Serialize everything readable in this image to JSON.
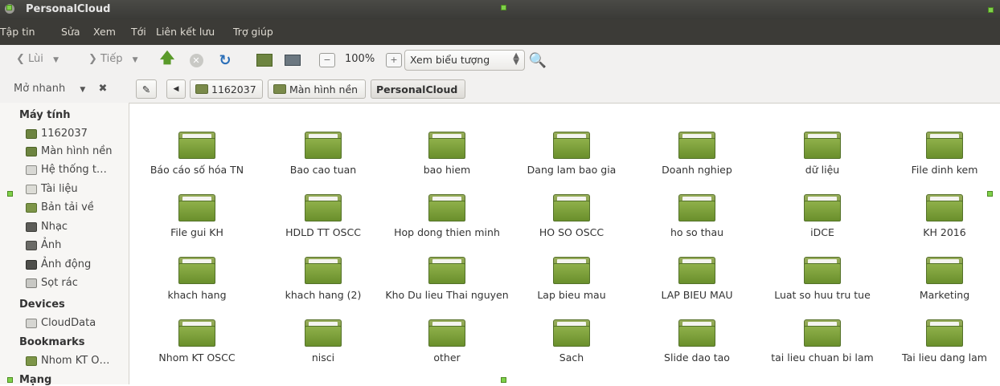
{
  "window": {
    "title": "PersonalCloud"
  },
  "menu": [
    "Tập tin",
    "Sửa",
    "Xem",
    "Tới",
    "Liên kết lưu",
    "Trợ giúp"
  ],
  "toolbar": {
    "back_label": "Lùi",
    "forward_label": "Tiếp",
    "zoom_value": "100%",
    "view_mode": "Xem biểu tượng"
  },
  "location": {
    "quick_label": "Mở nhanh",
    "crumbs": [
      "1162037",
      "Màn hình nền",
      "PersonalCloud"
    ]
  },
  "sidebar": {
    "sections": [
      {
        "heading": "Máy tính",
        "items": [
          "1162037",
          "Màn hình nền",
          "Hệ thống t…",
          "Tài liệu",
          "Bản tải về",
          "Nhạc",
          "Ảnh",
          "Ảnh động",
          "Sọt rác"
        ]
      },
      {
        "heading": "Devices",
        "items": [
          "CloudData"
        ]
      },
      {
        "heading": "Bookmarks",
        "items": [
          "Nhom KT O…"
        ]
      },
      {
        "heading": "Mạng",
        "items": []
      }
    ]
  },
  "folders": [
    [
      "Báo cáo số hóa TN",
      "Bao cao tuan",
      "bao hiem",
      "Dang lam bao gia",
      "Doanh nghiep",
      "dữ liệu",
      "File dinh kem"
    ],
    [
      "File gui KH",
      "HDLD TT OSCC",
      "Hop dong thien minh",
      "HO SO OSCC",
      "ho so thau",
      "iDCE",
      "KH 2016"
    ],
    [
      "khach hang",
      "khach hang (2)",
      "Kho Du lieu Thai nguyen",
      "Lap bieu mau",
      "LAP BIEU MAU",
      "Luat so huu tru tue",
      "Marketing"
    ],
    [
      "Nhom KT OSCC",
      "nisci",
      "other",
      "Sach",
      "Slide dao tao",
      "tai lieu chuan bi lam",
      "Tai lieu dang lam"
    ]
  ],
  "colors": {
    "folder": "#7a9a3a",
    "menubar": "#3c3b37",
    "sidebar": "#f7f6f4"
  }
}
